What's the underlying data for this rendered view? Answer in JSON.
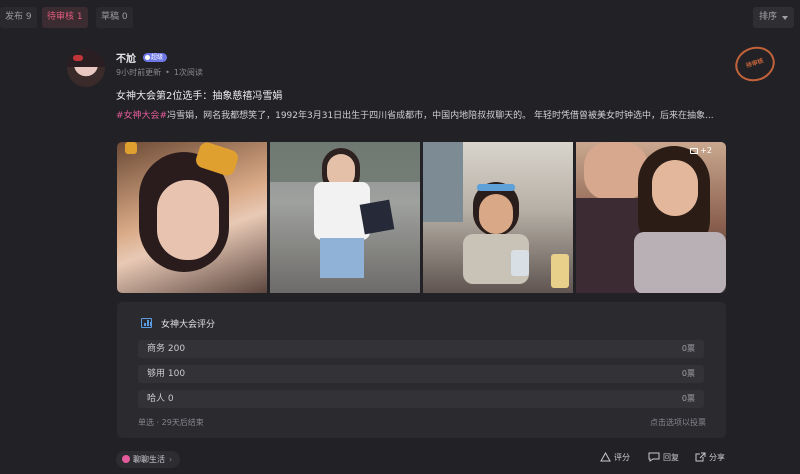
{
  "tabs": [
    {
      "label": "发布 9"
    },
    {
      "label": "待审核 1"
    },
    {
      "label": "草稿 0"
    }
  ],
  "sort_label": "排序",
  "post": {
    "author": "不尬",
    "author_badge": "超级",
    "time": "9小时前更新",
    "reads": "1次阅读",
    "stamp": "待审核",
    "title": "女神大会第2位选手：抽象慈禧冯雪娟",
    "tag": "#女神大会#",
    "excerpt": "冯雪娟，网名我都想笑了，1992年3月31日出生于四川省成都市，中国内地陪叔叔聊天的。 年轻时凭借曾被美女时钟选中，后来在抽象...",
    "image_more": "+2"
  },
  "poll": {
    "title": "女神大会评分",
    "options": [
      {
        "label": "商务 200",
        "count": "0票"
      },
      {
        "label": "够用 100",
        "count": "0票"
      },
      {
        "label": "哈人 0",
        "count": "0票"
      }
    ],
    "footer_left": "单选 · 29天后结束",
    "footer_right": "点击选项以投票"
  },
  "footer": {
    "circle": "聊聊生活",
    "rate": "评分",
    "reply": "回复",
    "share": "分享"
  },
  "colors": {
    "background": "#222226",
    "accent_pink": "#e35b7d",
    "poll_icon": "#5a9be6",
    "stamp": "#c2623a"
  }
}
